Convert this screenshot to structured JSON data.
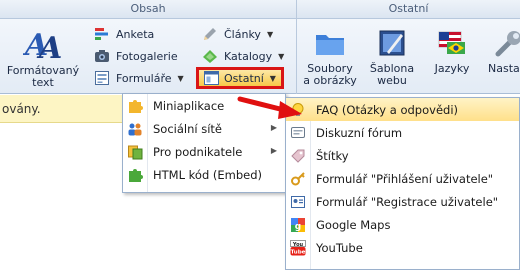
{
  "groups": {
    "obsah": "Obsah",
    "ostatni": "Ostatní"
  },
  "buttons": {
    "formatovany_line1": "Formátovaný",
    "formatovany_line2": "text",
    "anketa": "Anketa",
    "fotogalerie": "Fotogalerie",
    "formulare": "Formuláře",
    "clanky": "Články",
    "katalogy": "Katalogy",
    "ostatni": "Ostatní",
    "soubory_line1": "Soubory",
    "soubory_line2": "a obrázky",
    "sablona_line1": "Šablona",
    "sablona_line2": "webu",
    "jazyky": "Jazyky",
    "nastaveni": "Nasta"
  },
  "notice_text": "ovány.",
  "menu1": [
    {
      "label": "Miniaplikace",
      "icon": "puzzle-icon"
    },
    {
      "label": "Sociální sítě",
      "icon": "social-icon"
    },
    {
      "label": "Pro podnikatele",
      "icon": "business-icon"
    },
    {
      "label": "HTML kód (Embed)",
      "icon": "green-puzzle-icon"
    }
  ],
  "menu2": [
    {
      "label": "FAQ (Otázky a odpovědi)",
      "icon": "lightbulb-icon"
    },
    {
      "label": "Diskuzní fórum",
      "icon": "forum-icon"
    },
    {
      "label": "Štítky",
      "icon": "tag-icon"
    },
    {
      "label": "Formulář \"Přihlášení uživatele\"",
      "icon": "login-icon"
    },
    {
      "label": "Formulář \"Registrace uživatele\"",
      "icon": "registration-icon"
    },
    {
      "label": "Google Maps",
      "icon": "google-icon"
    },
    {
      "label": "YouTube",
      "icon": "youtube-icon"
    }
  ],
  "colors": {
    "highlight": "#d91515",
    "active_menu": "#ffe08a",
    "notice": "#fdf5c4"
  }
}
